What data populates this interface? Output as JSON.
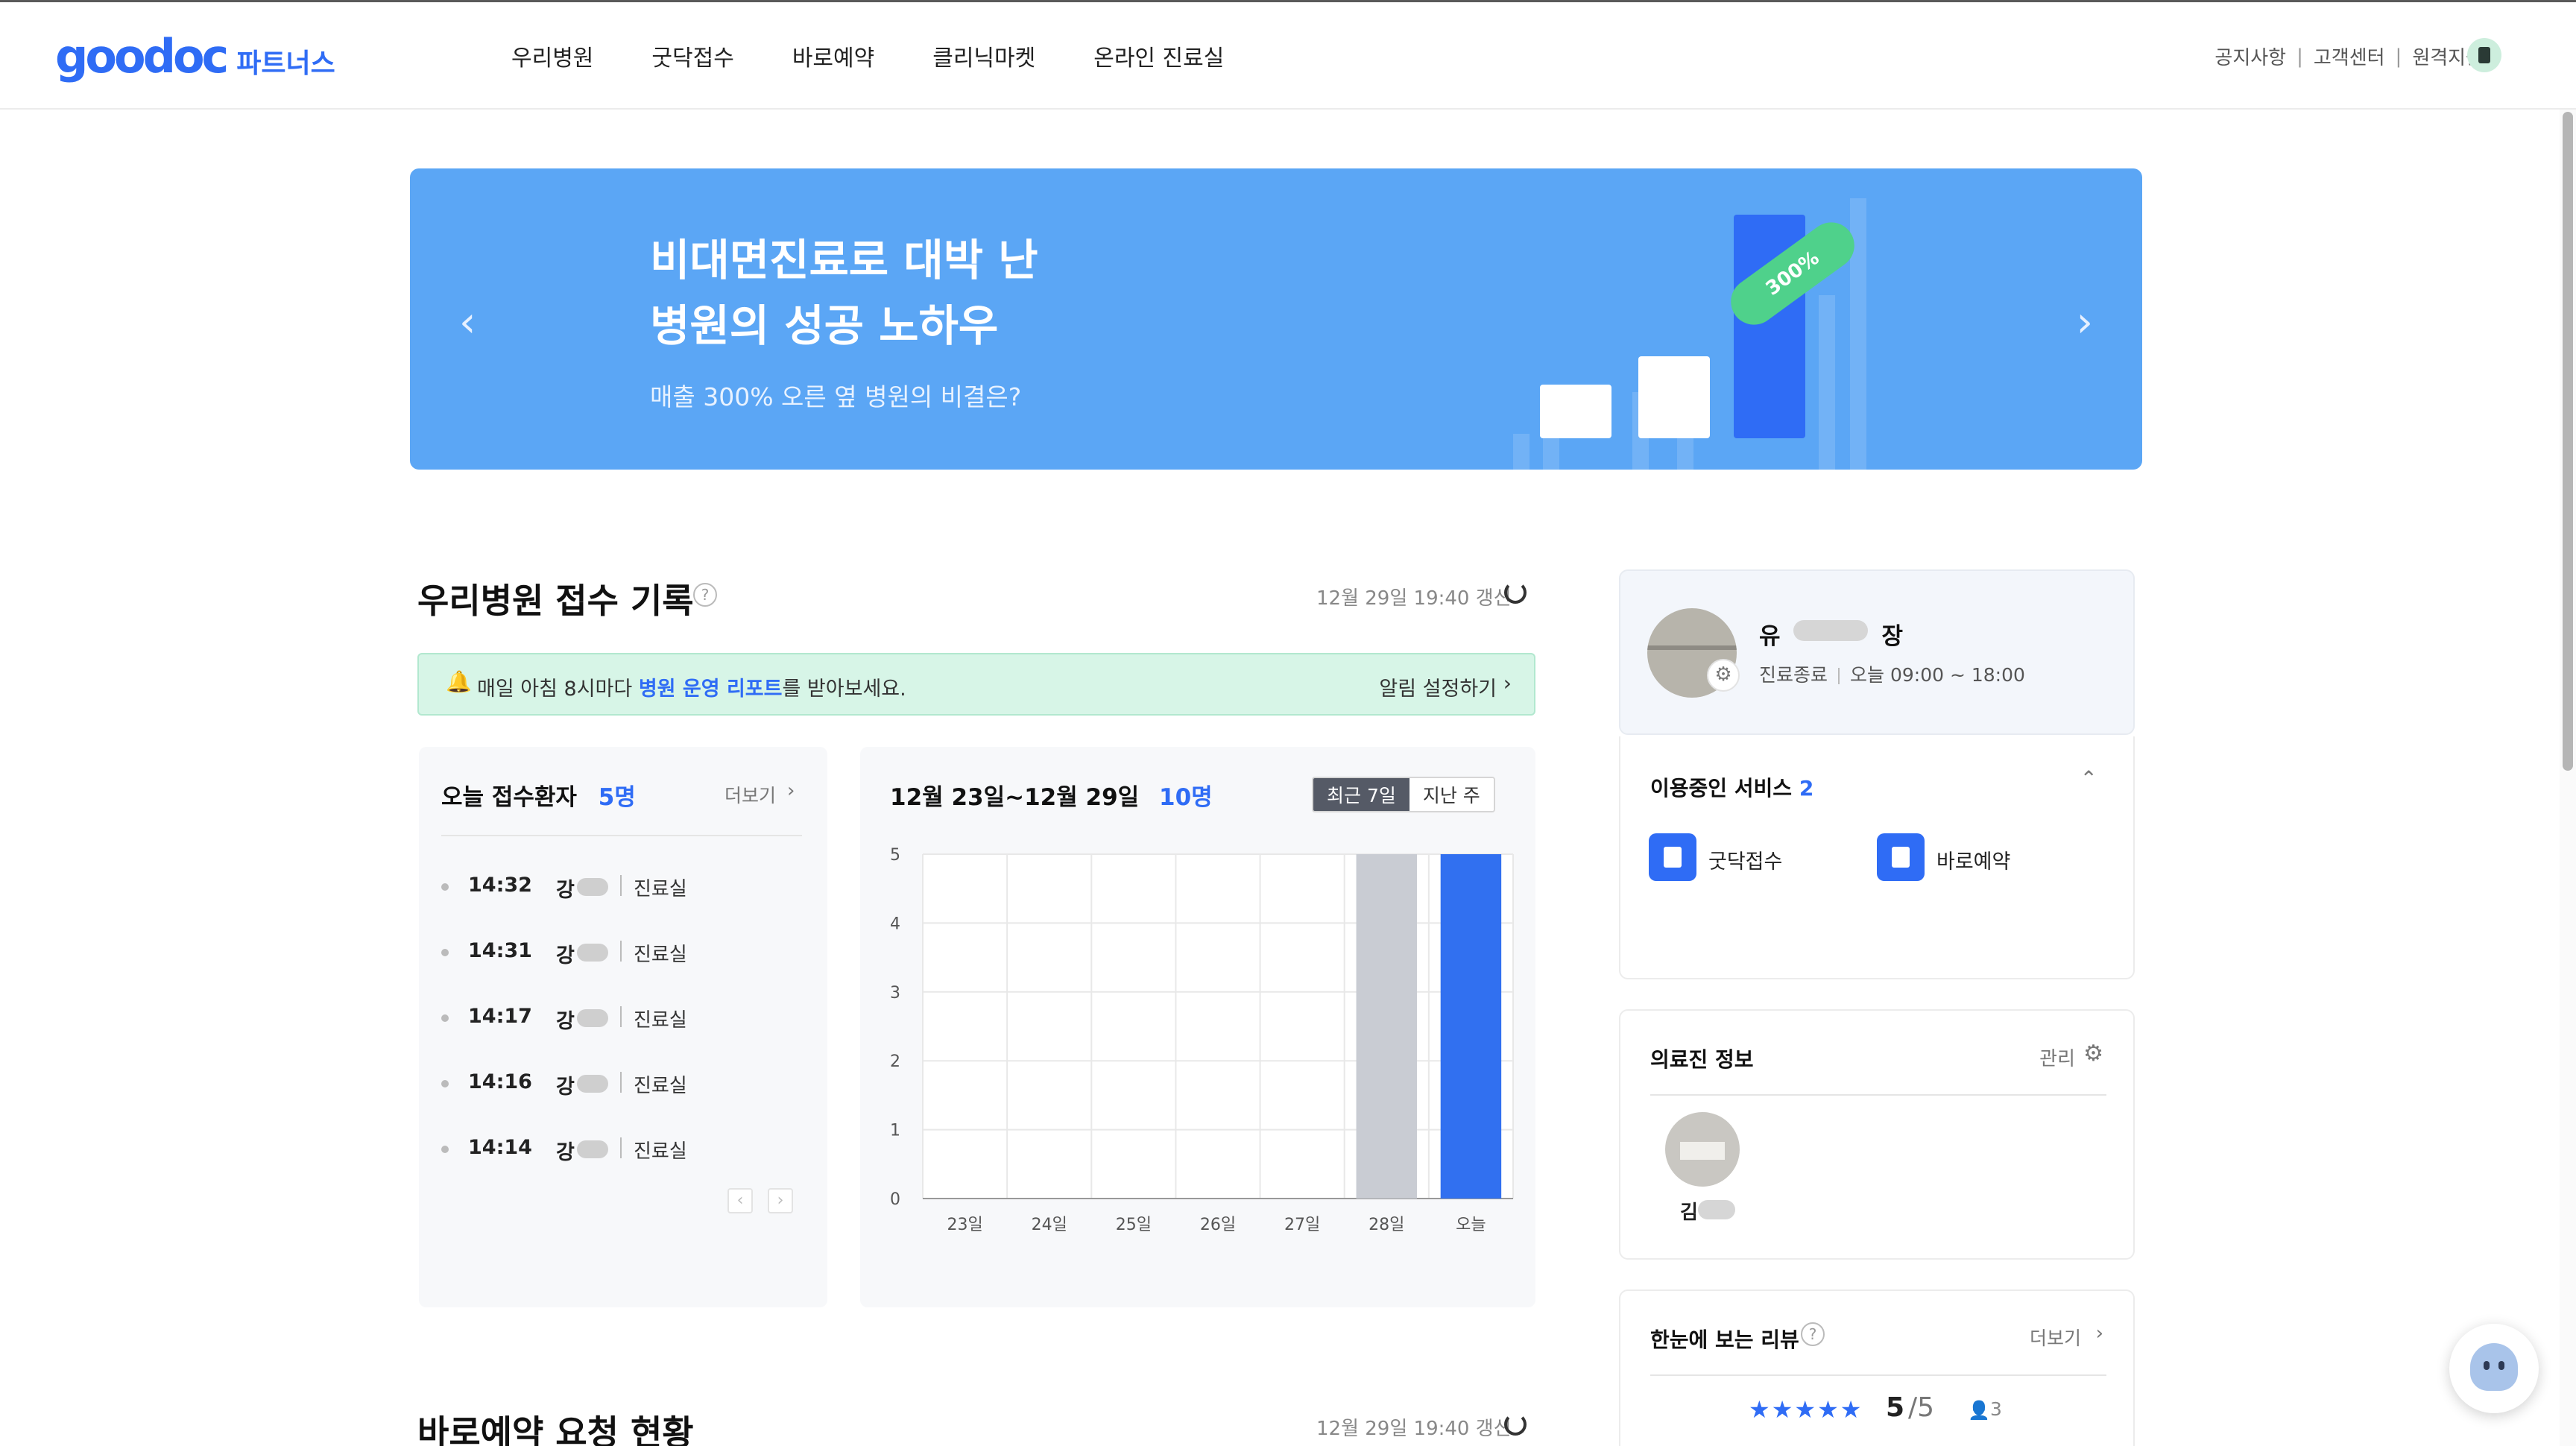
{
  "header": {
    "logo_word": "goodoc",
    "logo_partners": "파트너스",
    "nav": [
      "우리병원",
      "굿닥접수",
      "바로예약",
      "클리닉마켓",
      "온라인 진료실"
    ],
    "util_links": [
      "공지사항",
      "고객센터",
      "원격지원"
    ],
    "util_separator": "|"
  },
  "banner": {
    "title_line1": "비대면진료로 대박 난",
    "title_line2": "병원의 성공 노하우",
    "subtitle": "매출 300% 오른 옆 병원의 비결은?",
    "badge": "300%",
    "prev_arrow": "‹",
    "next_arrow": "›",
    "color": "#5ba6f5"
  },
  "reception": {
    "title": "우리병원 접수 기록",
    "updated": "12월 29일 19:40 갱신",
    "alert": {
      "bell": "🔔",
      "text_before": "매일 아침 8시마다 ",
      "text_link": "병원 운영 리포트",
      "text_after": "를 받아보세요.",
      "action": "알림 설정하기",
      "chevron": "›"
    },
    "today": {
      "title": "오늘 접수환자",
      "count": "5명",
      "more": "더보기",
      "chevron": "›",
      "patients": [
        {
          "time": "14:32",
          "name": "강",
          "room": "진료실"
        },
        {
          "time": "14:31",
          "name": "강",
          "room": "진료실"
        },
        {
          "time": "14:17",
          "name": "강",
          "room": "진료실"
        },
        {
          "time": "14:16",
          "name": "강",
          "room": "진료실"
        },
        {
          "time": "14:14",
          "name": "강",
          "room": "진료실"
        }
      ],
      "pager_prev": "‹",
      "pager_next": "›"
    },
    "weekly": {
      "title": "12월 23일~12월 29일",
      "count": "10명",
      "toggle_recent": "최근 7일",
      "toggle_last": "지난 주"
    }
  },
  "chart_data": {
    "type": "bar",
    "categories": [
      "23일",
      "24일",
      "25일",
      "26일",
      "27일",
      "28일",
      "오늘"
    ],
    "values": [
      0,
      0,
      0,
      0,
      0,
      5,
      5
    ],
    "ylim": [
      0,
      5
    ],
    "yticks": [
      "0",
      "1",
      "2",
      "3",
      "4",
      "5"
    ],
    "grid": true,
    "colors": {
      "past": "#c9ccd3",
      "today": "#3170f0"
    }
  },
  "reservation": {
    "title": "바로예약 요청 현황",
    "updated": "12월 29일 19:40 갱신"
  },
  "profile": {
    "name_start": "유",
    "name_end": "장",
    "status": "진료종료",
    "hours": "오늘 09:00 ~ 18:00",
    "gear": "⚙"
  },
  "services": {
    "title": "이용중인 서비스",
    "count": "2",
    "collapse": "⌃",
    "items": [
      {
        "label": "굿닥접수",
        "icon": "clinic-reception-icon"
      },
      {
        "label": "바로예약",
        "icon": "calendar-icon"
      }
    ]
  },
  "staff": {
    "title": "의료진 정보",
    "manage": "관리",
    "gear": "⚙",
    "doctor_name": "김"
  },
  "reviews": {
    "title": "한눈에 보는 리뷰",
    "more": "더보기",
    "chevron": "›",
    "stars": "★★★★★",
    "score": "5",
    "max": "/5",
    "user_icon": "👤",
    "count": "3"
  },
  "misc": {
    "help": "?"
  }
}
